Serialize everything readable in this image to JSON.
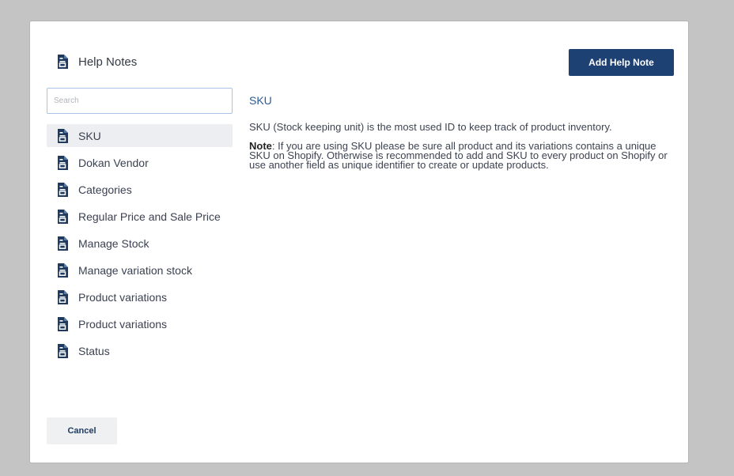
{
  "colors": {
    "backdrop": "#c3c4c3",
    "primary_button": "#1e4174",
    "icon": "#1e3a5f",
    "active_item_bg": "#eceef1",
    "content_title": "#2d5a93"
  },
  "header": {
    "title": "Help Notes",
    "icon": "document-icon",
    "add_button_label": "Add Help Note"
  },
  "search": {
    "placeholder": "Search",
    "value": ""
  },
  "sidebar": {
    "active_index": 0,
    "items": [
      {
        "label": "SKU"
      },
      {
        "label": "Dokan Vendor"
      },
      {
        "label": "Categories"
      },
      {
        "label": "Regular Price and Sale Price"
      },
      {
        "label": "Manage Stock"
      },
      {
        "label": "Manage variation stock"
      },
      {
        "label": "Product variations"
      },
      {
        "label": "Product variations"
      },
      {
        "label": "Status"
      }
    ]
  },
  "content": {
    "title": "SKU",
    "paragraph1": "SKU (Stock keeping unit) is the most used ID to keep track of product inventory.",
    "note_label": "Note",
    "note_text": ": If you are using SKU please be sure all product and its variations contains a unique SKU on Shopify. Otherwise is recommended to add and SKU to every product on Shopify or use another field as unique identifier to create or update products."
  },
  "footer": {
    "cancel_label": "Cancel"
  }
}
